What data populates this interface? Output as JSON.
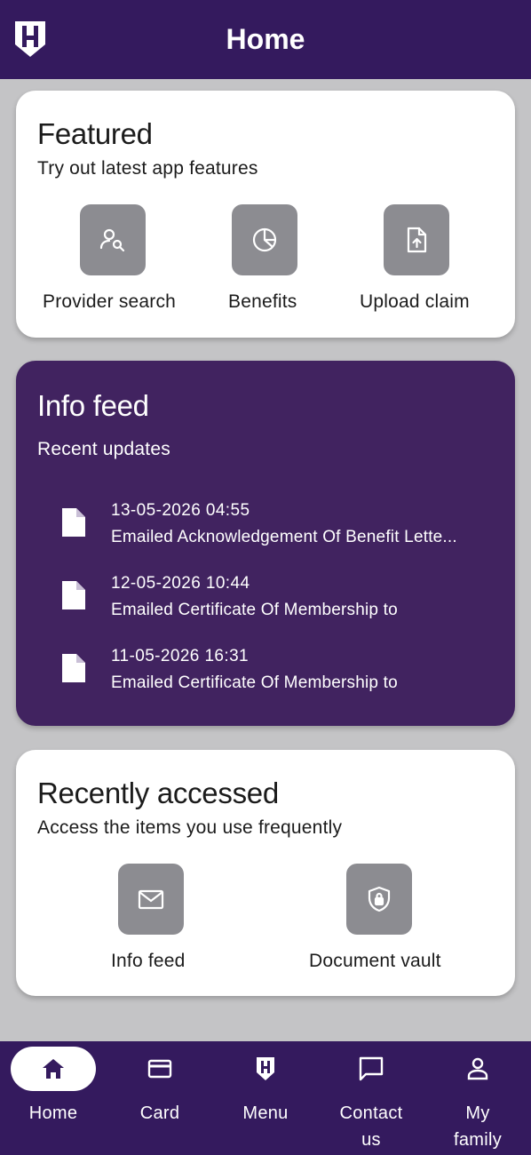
{
  "header": {
    "title": "Home"
  },
  "featured": {
    "title": "Featured",
    "subtitle": "Try out latest app features",
    "items": [
      {
        "label": "Provider search",
        "icon": "provider-search-icon"
      },
      {
        "label": "Benefits",
        "icon": "pie-chart-icon"
      },
      {
        "label": "Upload claim",
        "icon": "upload-file-icon"
      }
    ]
  },
  "info_feed": {
    "title": "Info feed",
    "subtitle": "Recent updates",
    "items": [
      {
        "date": "13-05-2026 04:55",
        "text": "Emailed Acknowledgement Of Benefit Lette..."
      },
      {
        "date": "12-05-2026 10:44",
        "text": "Emailed Certificate Of Membership to"
      },
      {
        "date": "11-05-2026 16:31",
        "text": "Emailed Certificate Of Membership to"
      }
    ]
  },
  "recent": {
    "title": "Recently accessed",
    "subtitle": "Access the items you use frequently",
    "items": [
      {
        "label": "Info feed",
        "icon": "mail-icon"
      },
      {
        "label": "Document vault",
        "icon": "shield-lock-icon"
      }
    ]
  },
  "bottom_nav": {
    "items": [
      {
        "label": "Home",
        "icon": "home-icon",
        "active": true
      },
      {
        "label": "Card",
        "icon": "card-icon"
      },
      {
        "label": "Menu",
        "icon": "menu-logo-icon"
      },
      {
        "label": "Contact us",
        "icon": "chat-icon"
      },
      {
        "label": "My family",
        "icon": "person-icon"
      }
    ]
  },
  "colors": {
    "brand_purple": "#341a5e",
    "card_purple": "#412360",
    "tile_gray": "#8c8c91",
    "page_bg": "#c4c4c6"
  }
}
